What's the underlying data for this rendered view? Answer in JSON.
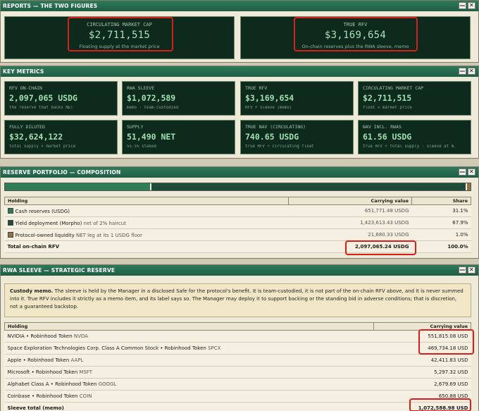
{
  "window_controls": {
    "minimize": "—",
    "close": "✕"
  },
  "reports": {
    "title": "REPORTS — THE TWO FIGURES",
    "cards": [
      {
        "label": "CIRCULATING MARKET CAP",
        "value": "$2,711,515",
        "sub": "Floating supply at the market price"
      },
      {
        "label": "TRUE RFV",
        "value": "$3,169,654",
        "sub": "On-chain reserves plus the RWA sleeve, memo"
      }
    ]
  },
  "key_metrics": {
    "title": "KEY METRICS",
    "items": [
      {
        "label": "RFV ON-CHAIN",
        "value": "2,097,065 USDG",
        "sub": "the reserve that backs NET"
      },
      {
        "label": "RWA SLEEVE",
        "value": "$1,072,589",
        "sub": "memo · team-custodied"
      },
      {
        "label": "TRUE RFV",
        "value": "$3,169,654",
        "sub": "RFV + sleeve (memo)"
      },
      {
        "label": "CIRCULATING MARKET CAP",
        "value": "$2,711,515",
        "sub": "float × market price"
      },
      {
        "label": "FULLY DILUTED",
        "value": "$32,624,122",
        "sub": "total supply × market price"
      },
      {
        "label": "SUPPLY",
        "value": "51,490 NET",
        "sub": "55.5% staked"
      },
      {
        "label": "TRUE NAV (CIRCULATING)",
        "value": "740.65 USDG",
        "sub": "true RFV ÷ circulating float"
      },
      {
        "label": "NAV INCL. RWAS",
        "value": "61.56 USDG",
        "sub": "true RFV ÷ total supply · sleeve at m."
      }
    ]
  },
  "reserve": {
    "title": "RESERVE PORTFOLIO — COMPOSITION",
    "bar": [
      {
        "share": 31.1,
        "color": "#2e7d55"
      },
      {
        "share": 67.9,
        "color": "#1f4d3a"
      },
      {
        "share": 1.0,
        "color": "#8b7447"
      }
    ],
    "headers": {
      "holding": "Holding",
      "value": "Carrying value",
      "share": "Share"
    },
    "rows": [
      {
        "name": "Cash reserves (USDG)",
        "note": "",
        "value": "651,771.48 USDG",
        "share": "31.1%",
        "color": "#2e7d55"
      },
      {
        "name": "Yield deployment (Morpho)",
        "note": "net of 2% haircut",
        "value": "1,423,613.43 USDG",
        "share": "67.9%",
        "color": "#1f4d3a"
      },
      {
        "name": "Protocol-owned liquidity",
        "note": "NET leg at its 1 USDG floor",
        "value": "21,680.33 USDG",
        "share": "1.0%",
        "color": "#8b7447"
      }
    ],
    "total": {
      "label": "Total on-chain RFV",
      "value": "2,097,065.24 USDG",
      "share": "100.0%"
    }
  },
  "rwa": {
    "title": "RWA SLEEVE — STRATEGIC RESERVE",
    "memo_title": "Custody memo.",
    "memo_text": "The sleeve is held by the Manager in a disclosed Safe for the protocol's benefit. It is team-custodied, it is not part of the on-chain RFV above, and it is never summed into it. True RFV includes it strictly as a memo item, and its label says so. The Manager may deploy it to support backing or the standing bid in adverse conditions; that is discretion, not a guaranteed backstop.",
    "headers": {
      "holding": "Holding",
      "value": "Carrying value"
    },
    "rows": [
      {
        "name": "NVIDIA • Robinhood Token",
        "ticker": "NVDA",
        "value": "551,815.08 USD"
      },
      {
        "name": "Space Exploration Technologies Corp. Class A Common Stock • Robinhood Token",
        "ticker": "SPCX",
        "value": "469,734.18 USD"
      },
      {
        "name": "Apple • Robinhood Token",
        "ticker": "AAPL",
        "value": "42,411.83 USD"
      },
      {
        "name": "Microsoft • Robinhood Token",
        "ticker": "MSFT",
        "value": "5,297.32 USD"
      },
      {
        "name": "Alphabet Class A • Robinhood Token",
        "ticker": "GOOGL",
        "value": "2,679.69 USD"
      },
      {
        "name": "Coinbase • Robinhood Token",
        "ticker": "COIN",
        "value": "650.88 USD"
      }
    ],
    "total": {
      "label": "Sleeve total (memo)",
      "value": "1,072,588.98 USD"
    }
  }
}
